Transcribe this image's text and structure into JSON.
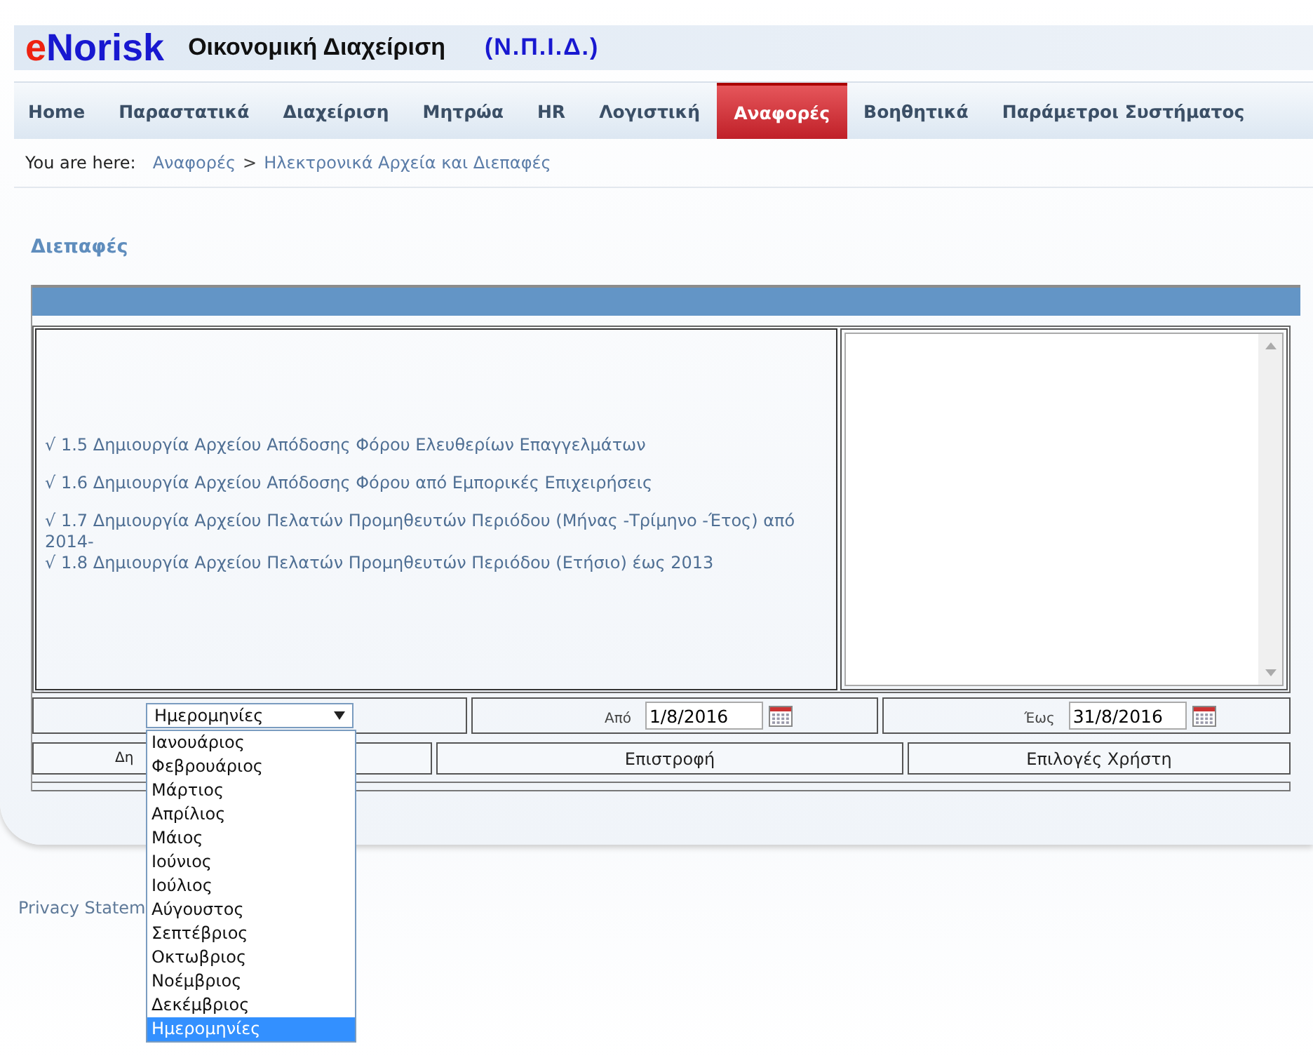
{
  "header": {
    "logo_prefix": "e",
    "logo_name": "Norisk",
    "app_title": "Οικονομική Διαχείριση",
    "org": "(Ν.Π.Ι.Δ.)"
  },
  "nav": [
    {
      "label": "Home",
      "selected": false
    },
    {
      "label": "Παραστατικά",
      "selected": false
    },
    {
      "label": "Διαχείριση",
      "selected": false
    },
    {
      "label": "Μητρώα",
      "selected": false
    },
    {
      "label": "HR",
      "selected": false
    },
    {
      "label": "Λογιστική",
      "selected": false
    },
    {
      "label": "Αναφορές",
      "selected": true
    },
    {
      "label": "Βοηθητικά",
      "selected": false
    },
    {
      "label": "Παράμετροι Συστήματος",
      "selected": false
    }
  ],
  "breadcrumb": {
    "label": "You are here:",
    "items": [
      "Αναφορές",
      "Ηλεκτρονικά Αρχεία και Διεπαφές"
    ],
    "separator": ">"
  },
  "section_title": "Διεπαφές",
  "report_links": [
    "√ 1.5 Δημιουργία Αρχείου Απόδοσης Φόρου Ελευθερίων Επαγγελμάτων",
    "√ 1.6 Δημιουργία Αρχείου Απόδοσης Φόρου από Εμπορικές Επιχειρήσεις",
    "√ 1.7 Δημιουργία Αρχείου Πελατών Προμηθευτών Περιόδου (Μήνας -Τρίμηνο -Έτος) από 2014-",
    "√ 1.8 Δημιουργία Αρχείου Πελατών Προμηθευτών Περιόδου (Ετήσιο) έως 2013"
  ],
  "filters": {
    "period": {
      "value": "Ημερομηνίες",
      "expanded": true,
      "options": [
        {
          "label": "Ιανουάριος",
          "selected": false
        },
        {
          "label": "Φεβρουάριος",
          "selected": false
        },
        {
          "label": "Μάρτιος",
          "selected": false
        },
        {
          "label": "Απρίλιος",
          "selected": false
        },
        {
          "label": "Μάιος",
          "selected": false
        },
        {
          "label": "Ιούνιος",
          "selected": false
        },
        {
          "label": "Ιούλιος",
          "selected": false
        },
        {
          "label": "Αύγουστος",
          "selected": false
        },
        {
          "label": "Σεπτέβριος",
          "selected": false
        },
        {
          "label": "Οκτωβριος",
          "selected": false
        },
        {
          "label": "Νοέμβριος",
          "selected": false
        },
        {
          "label": "Δεκέμβριος",
          "selected": false
        },
        {
          "label": "Ημερομηνίες",
          "selected": true
        }
      ]
    },
    "from": {
      "label": "Από",
      "value": "1/8/2016"
    },
    "to": {
      "label": "Έως",
      "value": "31/8/2016"
    }
  },
  "buttons": [
    "Δη",
    "Επιστροφή",
    "Επιλογές Χρήστη"
  ],
  "footer": {
    "link": "Privacy Statem"
  }
}
